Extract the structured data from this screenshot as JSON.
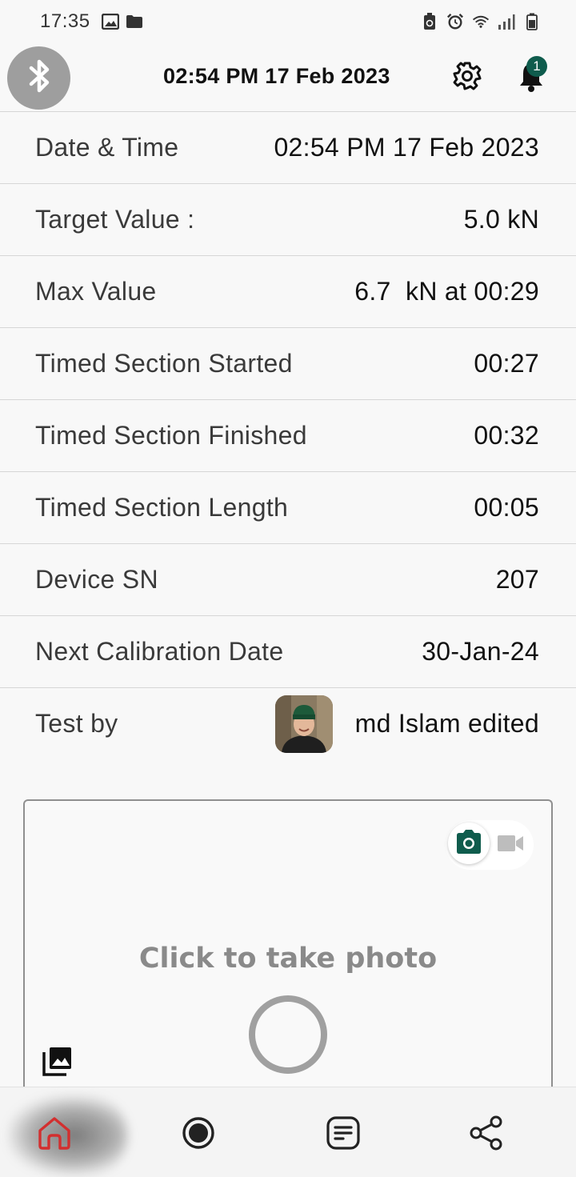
{
  "status_bar": {
    "time": "17:35",
    "left_icons": [
      "image-icon",
      "folder-icon"
    ],
    "right_icons": [
      "battery-saver-icon",
      "alarm-icon",
      "wifi-icon",
      "signal-icon",
      "battery-icon"
    ]
  },
  "header": {
    "title": "02:54 PM 17 Feb 2023",
    "notification_count": "1"
  },
  "details": [
    {
      "label": "Date & Time",
      "value": "02:54 PM 17 Feb 2023"
    },
    {
      "label": "Target Value :",
      "value": "5.0 kN"
    },
    {
      "label": "Max Value",
      "value": "6.7  kN at 00:29"
    },
    {
      "label": "Timed Section Started",
      "value": "00:27"
    },
    {
      "label": "Timed Section Finished",
      "value": "00:32"
    },
    {
      "label": "Timed Section Length",
      "value": "00:05"
    },
    {
      "label": "Device SN",
      "value": "207"
    },
    {
      "label": "Next Calibration Date",
      "value": "30-Jan-24"
    }
  ],
  "tester": {
    "label": "Test by",
    "name": "md Islam edited"
  },
  "photo": {
    "prompt": "Click to take photo",
    "mode_selected": "photo"
  },
  "bottom_nav": [
    {
      "id": "home",
      "icon": "home-icon",
      "active": true
    },
    {
      "id": "record",
      "icon": "record-icon",
      "active": false
    },
    {
      "id": "reports",
      "icon": "notes-icon",
      "active": false
    },
    {
      "id": "share",
      "icon": "share-icon",
      "active": false
    }
  ],
  "colors": {
    "accent": "#0f5c4d",
    "active_nav": "#d32f2f",
    "bluetooth_bg": "#9e9e9e"
  }
}
